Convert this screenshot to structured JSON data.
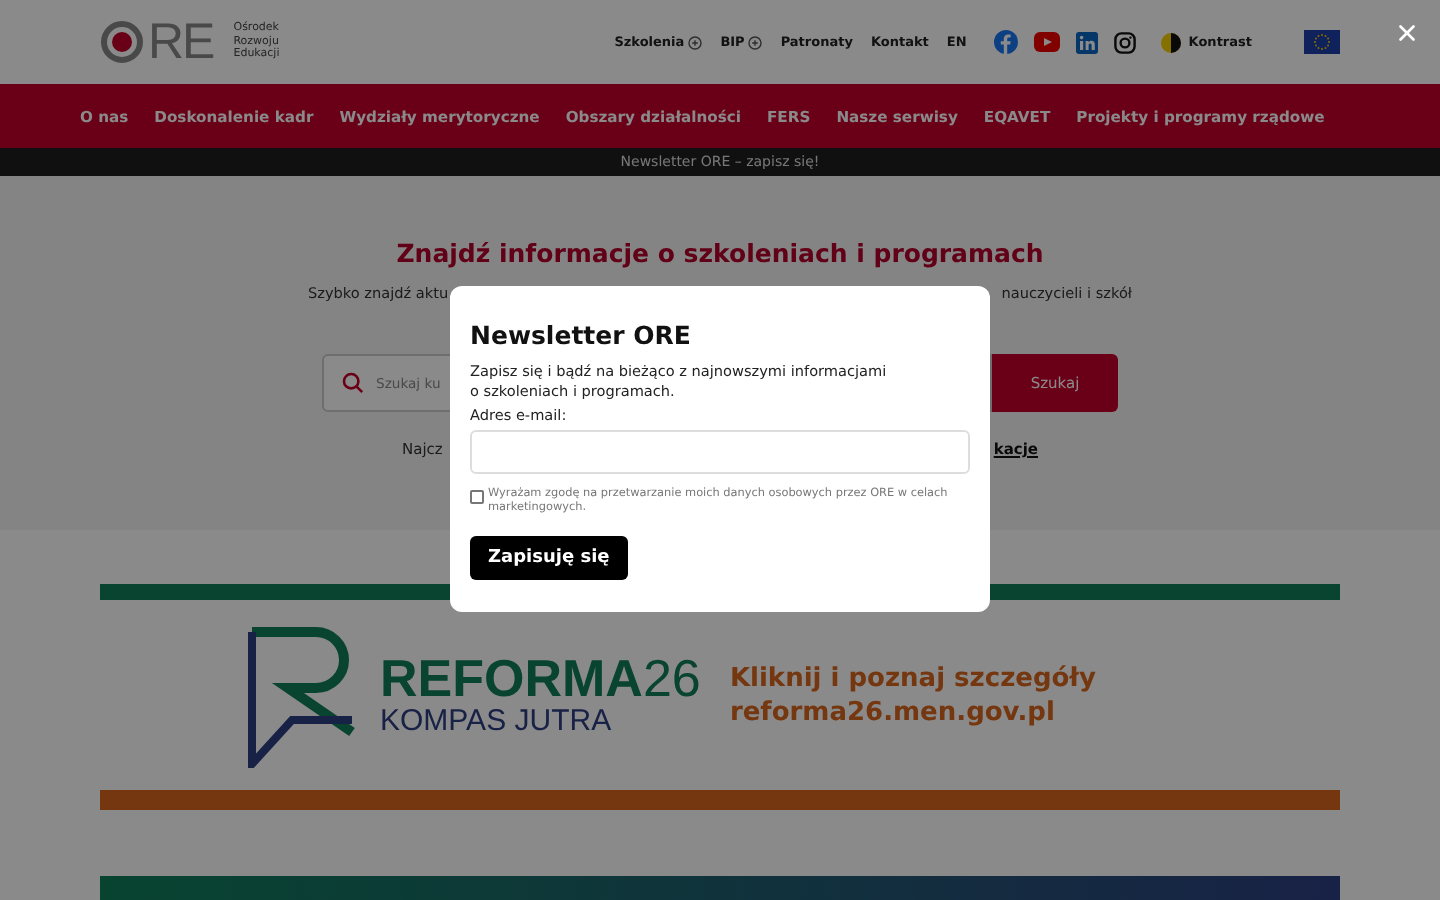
{
  "header": {
    "logo": {
      "letters": "RE",
      "lines": [
        "Ośrodek",
        "Rozwoju",
        "Edukacji"
      ]
    },
    "links": [
      {
        "label": "Szkolenia",
        "expandable": true
      },
      {
        "label": "BIP",
        "expandable": true
      },
      {
        "label": "Patronaty",
        "expandable": false
      },
      {
        "label": "Kontakt",
        "expandable": false
      },
      {
        "label": "EN",
        "expandable": false
      }
    ],
    "contrast": "Kontrast"
  },
  "nav": [
    "O nas",
    "Doskonalenie kadr",
    "Wydziały merytoryczne",
    "Obszary działalności",
    "FERS",
    "Nasze serwisy",
    "EQAVET",
    "Projekty i programy rządowe"
  ],
  "announcement": "Newsletter ORE – zapisz się!",
  "hero": {
    "title": "Znajdź informacje o szkoleniach i programach",
    "subtitle_start": "Szybko znajdź aktu",
    "subtitle_end": "nauczycieli i szkół",
    "search_placeholder": "Szukaj ku",
    "search_button": "Szukaj",
    "popular_start": "Najcz",
    "popular_end": "kacje"
  },
  "banner": {
    "brand": "**REFORMA**26",
    "tagline": "KOMPAS JUTRA",
    "cta": "Kliknij i poznaj szczegóły",
    "url": "reforma26.men.gov.pl"
  },
  "modal": {
    "title": "Newsletter ORE",
    "text": "Zapisz się i bądź na bieżąco z najnowszymi informacjami\no szkoleniach i programach.",
    "email_label": "Adres e-mail:",
    "consent": {
      "label": "Wyrażam zgodę na przetwarzanie moich danych osobowych przez ORE w celach marketingowych.",
      "checked": false
    },
    "submit": "Zapisuję się"
  }
}
